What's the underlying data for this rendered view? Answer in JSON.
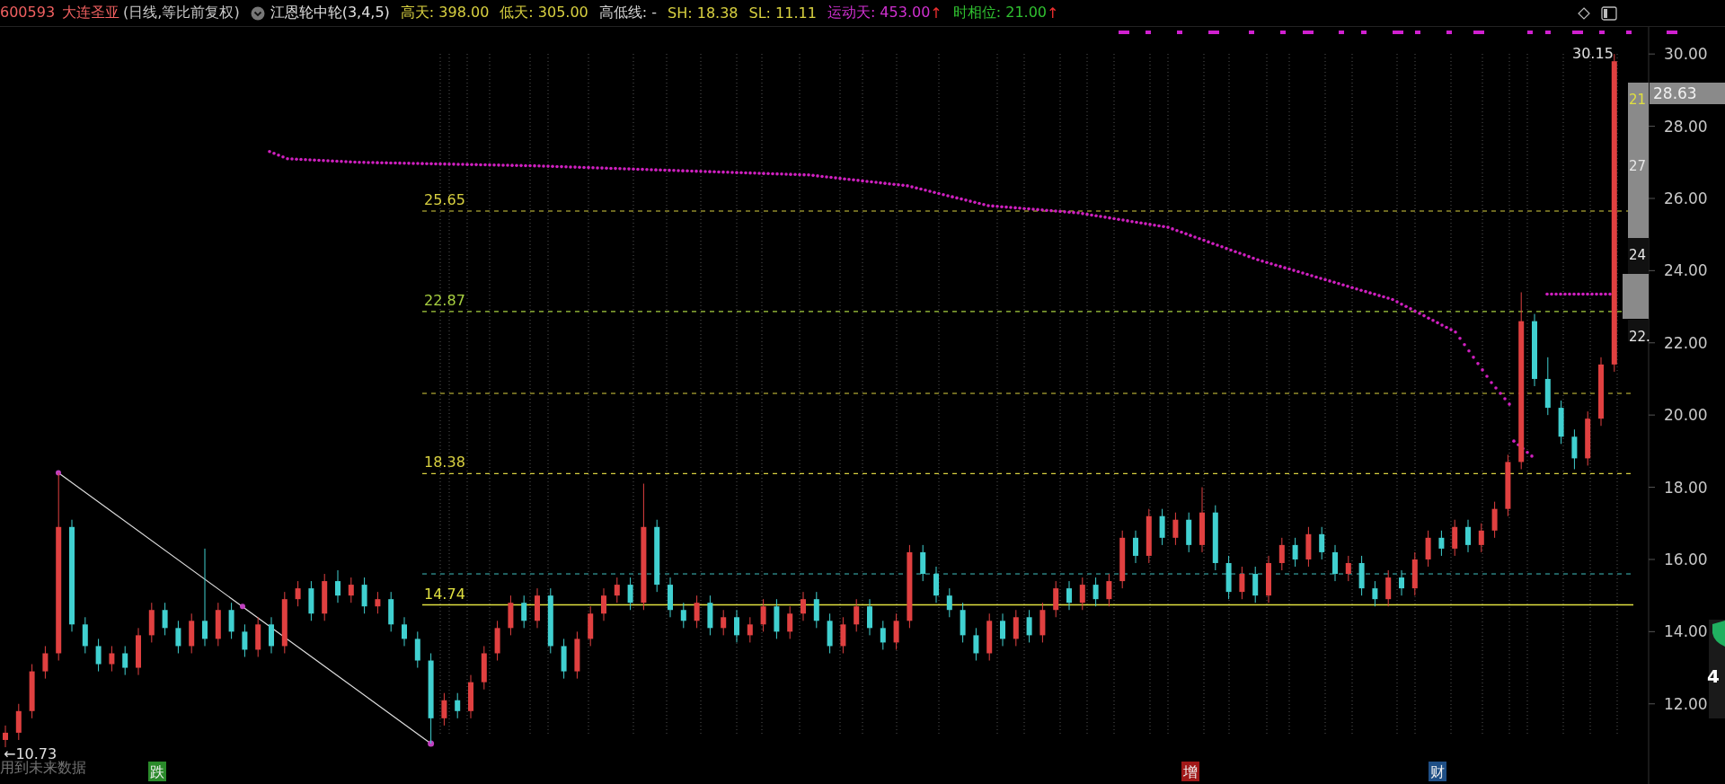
{
  "header": {
    "code": "600593",
    "name": "大连圣亚",
    "period": "(日线,等比前复权)",
    "indicator": "江恩轮中轮(3,4,5)",
    "stats": [
      {
        "label": "高天: 398.00",
        "color": "#d8d040"
      },
      {
        "label": "低天: 305.00",
        "color": "#d8d040"
      },
      {
        "label": "高低线: -",
        "color": "#d0d0d0"
      },
      {
        "label": "SH: 18.38",
        "color": "#d8d040"
      },
      {
        "label": "SL: 11.11",
        "color": "#d8d040"
      },
      {
        "label": "运动天: 453.00",
        "color": "#d030d0",
        "mark": "↑"
      },
      {
        "label": "时相位: 21.00",
        "color": "#30c030",
        "mark": "↑"
      }
    ]
  },
  "axis": {
    "current_price": "28.63"
  },
  "levels": [
    {
      "label": "25.65",
      "kind": "dashed",
      "color": "#d8d040"
    },
    {
      "label": "22.87",
      "kind": "dashed",
      "color": "#a8d040"
    },
    {
      "label": "18.38",
      "kind": "dashed",
      "color": "#d8d040"
    },
    {
      "label": "14.74",
      "kind": "solid",
      "color": "#e0e040"
    }
  ],
  "annotations": {
    "high": "30.15",
    "low": "←10.73",
    "warning": "用到未来数据"
  },
  "side_boxes": [
    {
      "label": "21",
      "kind": "gray"
    },
    {
      "label": "27",
      "kind": "gray"
    },
    {
      "label": "24",
      "kind": "dark"
    },
    {
      "label": "22.",
      "kind": "dark"
    }
  ],
  "widget": {
    "value": "4"
  },
  "chart": {
    "chart_data": {
      "type": "candlestick",
      "yticks": [
        {
          "value": 30,
          "label": "30.00"
        },
        {
          "value": 28,
          "label": "28.00"
        },
        {
          "value": 26,
          "label": "26.00"
        },
        {
          "value": 24,
          "label": "24.00"
        },
        {
          "value": 22,
          "label": "22.00"
        },
        {
          "value": 20,
          "label": "20.00"
        },
        {
          "value": 18,
          "label": "18.00"
        },
        {
          "value": 16,
          "label": "16.00"
        },
        {
          "value": 14,
          "label": "14.00"
        },
        {
          "value": 12,
          "label": "12.00"
        }
      ],
      "ylim": [
        9.78,
        30.75
      ],
      "ohlc": [
        [
          11.0,
          11.4,
          10.8,
          11.2
        ],
        [
          11.2,
          12.0,
          11.0,
          11.8
        ],
        [
          11.8,
          13.1,
          11.6,
          12.9
        ],
        [
          12.9,
          13.6,
          12.7,
          13.4
        ],
        [
          13.4,
          18.4,
          13.2,
          16.9
        ],
        [
          16.9,
          17.1,
          14.0,
          14.2
        ],
        [
          14.2,
          14.4,
          13.4,
          13.6
        ],
        [
          13.6,
          13.8,
          12.9,
          13.1
        ],
        [
          13.1,
          13.6,
          12.9,
          13.4
        ],
        [
          13.4,
          13.6,
          12.8,
          13.0
        ],
        [
          13.0,
          14.1,
          12.8,
          13.9
        ],
        [
          13.9,
          14.8,
          13.7,
          14.6
        ],
        [
          14.6,
          14.8,
          13.9,
          14.1
        ],
        [
          14.1,
          14.3,
          13.4,
          13.6
        ],
        [
          13.6,
          14.5,
          13.4,
          14.3
        ],
        [
          14.3,
          16.3,
          13.6,
          13.8
        ],
        [
          13.8,
          14.8,
          13.6,
          14.6
        ],
        [
          14.6,
          14.8,
          13.8,
          14.0
        ],
        [
          14.0,
          14.2,
          13.3,
          13.5
        ],
        [
          13.5,
          14.4,
          13.3,
          14.2
        ],
        [
          14.2,
          14.4,
          13.4,
          13.6
        ],
        [
          13.6,
          15.1,
          13.4,
          14.9
        ],
        [
          14.9,
          15.4,
          14.7,
          15.2
        ],
        [
          15.2,
          15.4,
          14.3,
          14.5
        ],
        [
          14.5,
          15.6,
          14.3,
          15.4
        ],
        [
          15.4,
          15.7,
          14.8,
          15.0
        ],
        [
          15.0,
          15.5,
          14.8,
          15.3
        ],
        [
          15.3,
          15.5,
          14.5,
          14.7
        ],
        [
          14.7,
          15.1,
          14.5,
          14.9
        ],
        [
          14.9,
          15.1,
          14.0,
          14.2
        ],
        [
          14.2,
          14.4,
          13.6,
          13.8
        ],
        [
          13.8,
          14.0,
          13.0,
          13.2
        ],
        [
          13.2,
          13.4,
          10.9,
          11.6
        ],
        [
          11.6,
          12.3,
          11.4,
          12.1
        ],
        [
          12.1,
          12.3,
          11.6,
          11.8
        ],
        [
          11.8,
          12.8,
          11.6,
          12.6
        ],
        [
          12.6,
          13.6,
          12.4,
          13.4
        ],
        [
          13.4,
          14.3,
          13.2,
          14.1
        ],
        [
          14.1,
          15.0,
          13.9,
          14.8
        ],
        [
          14.8,
          15.0,
          14.1,
          14.3
        ],
        [
          14.3,
          15.2,
          14.1,
          15.0
        ],
        [
          15.0,
          15.2,
          13.4,
          13.6
        ],
        [
          13.6,
          13.8,
          12.7,
          12.9
        ],
        [
          12.9,
          14.0,
          12.7,
          13.8
        ],
        [
          13.8,
          14.7,
          13.6,
          14.5
        ],
        [
          14.5,
          15.2,
          14.3,
          15.0
        ],
        [
          15.0,
          15.5,
          14.8,
          15.3
        ],
        [
          15.3,
          15.5,
          14.6,
          14.8
        ],
        [
          14.8,
          18.1,
          14.6,
          16.9
        ],
        [
          16.9,
          17.1,
          15.1,
          15.3
        ],
        [
          15.3,
          15.5,
          14.4,
          14.6
        ],
        [
          14.6,
          14.8,
          14.1,
          14.3
        ],
        [
          14.3,
          15.0,
          14.1,
          14.8
        ],
        [
          14.8,
          15.0,
          13.9,
          14.1
        ],
        [
          14.1,
          14.6,
          13.9,
          14.4
        ],
        [
          14.4,
          14.6,
          13.7,
          13.9
        ],
        [
          13.9,
          14.4,
          13.7,
          14.2
        ],
        [
          14.2,
          14.9,
          14.0,
          14.7
        ],
        [
          14.7,
          14.9,
          13.8,
          14.0
        ],
        [
          14.0,
          14.7,
          13.8,
          14.5
        ],
        [
          14.5,
          15.1,
          14.3,
          14.9
        ],
        [
          14.9,
          15.1,
          14.1,
          14.3
        ],
        [
          14.3,
          14.5,
          13.4,
          13.6
        ],
        [
          13.6,
          14.4,
          13.4,
          14.2
        ],
        [
          14.2,
          14.9,
          14.0,
          14.7
        ],
        [
          14.7,
          14.9,
          13.9,
          14.1
        ],
        [
          14.1,
          14.3,
          13.5,
          13.7
        ],
        [
          13.7,
          14.5,
          13.5,
          14.3
        ],
        [
          14.3,
          16.4,
          14.1,
          16.2
        ],
        [
          16.2,
          16.4,
          15.4,
          15.6
        ],
        [
          15.6,
          15.8,
          14.8,
          15.0
        ],
        [
          15.0,
          15.2,
          14.4,
          14.6
        ],
        [
          14.6,
          14.8,
          13.7,
          13.9
        ],
        [
          13.9,
          14.1,
          13.2,
          13.4
        ],
        [
          13.4,
          14.5,
          13.2,
          14.3
        ],
        [
          14.3,
          14.5,
          13.6,
          13.8
        ],
        [
          13.8,
          14.6,
          13.6,
          14.4
        ],
        [
          14.4,
          14.6,
          13.7,
          13.9
        ],
        [
          13.9,
          14.8,
          13.7,
          14.6
        ],
        [
          14.6,
          15.4,
          14.4,
          15.2
        ],
        [
          15.2,
          15.4,
          14.6,
          14.8
        ],
        [
          14.8,
          15.5,
          14.6,
          15.3
        ],
        [
          15.3,
          15.5,
          14.7,
          14.9
        ],
        [
          14.9,
          15.6,
          14.7,
          15.4
        ],
        [
          15.4,
          16.8,
          15.2,
          16.6
        ],
        [
          16.6,
          16.8,
          15.9,
          16.1
        ],
        [
          16.1,
          17.4,
          15.9,
          17.2
        ],
        [
          17.2,
          17.4,
          16.4,
          16.6
        ],
        [
          16.6,
          17.3,
          16.4,
          17.1
        ],
        [
          17.1,
          17.3,
          16.2,
          16.4
        ],
        [
          16.4,
          18.0,
          16.2,
          17.3
        ],
        [
          17.3,
          17.5,
          15.7,
          15.9
        ],
        [
          15.9,
          16.1,
          14.9,
          15.1
        ],
        [
          15.1,
          15.8,
          14.9,
          15.6
        ],
        [
          15.6,
          15.8,
          14.8,
          15.0
        ],
        [
          15.0,
          16.1,
          14.8,
          15.9
        ],
        [
          15.9,
          16.6,
          15.7,
          16.4
        ],
        [
          16.4,
          16.6,
          15.8,
          16.0
        ],
        [
          16.0,
          16.9,
          15.8,
          16.7
        ],
        [
          16.7,
          16.9,
          16.0,
          16.2
        ],
        [
          16.2,
          16.4,
          15.4,
          15.6
        ],
        [
          15.6,
          16.1,
          15.4,
          15.9
        ],
        [
          15.9,
          16.1,
          15.0,
          15.2
        ],
        [
          15.2,
          15.4,
          14.7,
          14.9
        ],
        [
          14.9,
          15.7,
          14.7,
          15.5
        ],
        [
          15.5,
          15.7,
          15.0,
          15.2
        ],
        [
          15.2,
          16.2,
          15.0,
          16.0
        ],
        [
          16.0,
          16.8,
          15.8,
          16.6
        ],
        [
          16.6,
          16.8,
          16.1,
          16.3
        ],
        [
          16.3,
          17.1,
          16.1,
          16.9
        ],
        [
          16.9,
          17.1,
          16.2,
          16.4
        ],
        [
          16.4,
          17.0,
          16.2,
          16.8
        ],
        [
          16.8,
          17.6,
          16.6,
          17.4
        ],
        [
          17.4,
          18.9,
          17.2,
          18.7
        ],
        [
          18.7,
          23.4,
          18.5,
          22.6
        ],
        [
          22.6,
          22.8,
          20.8,
          21.0
        ],
        [
          21.0,
          21.6,
          20.0,
          20.2
        ],
        [
          20.2,
          20.4,
          19.2,
          19.4
        ],
        [
          19.4,
          19.6,
          18.5,
          18.8
        ],
        [
          18.8,
          20.1,
          18.6,
          19.9
        ],
        [
          19.9,
          21.6,
          19.7,
          21.4
        ],
        [
          21.4,
          30.0,
          21.2,
          29.8
        ]
      ]
    }
  },
  "events": [
    {
      "label": "跌",
      "color": "#2a8a2a"
    },
    {
      "label": "增",
      "color": "#a01818"
    },
    {
      "label": "财",
      "color": "#1f4f86"
    }
  ]
}
